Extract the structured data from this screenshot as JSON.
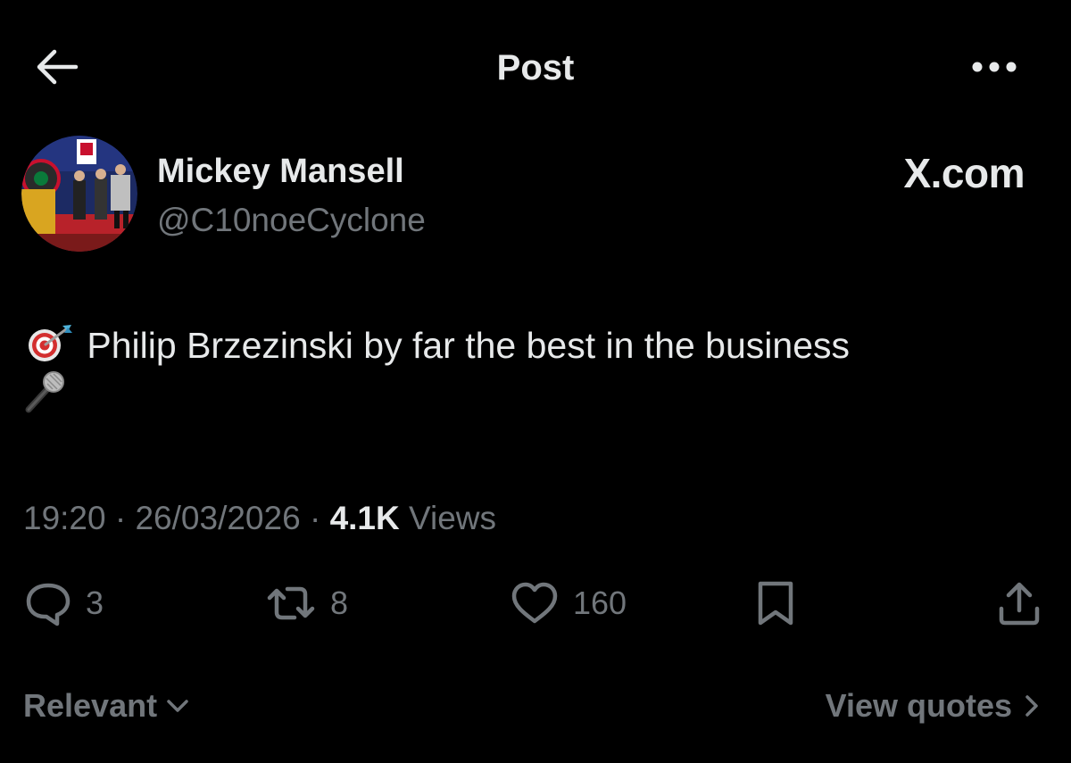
{
  "header": {
    "title": "Post",
    "back_icon": "arrow-left-icon",
    "more_icon": "more-horizontal-icon"
  },
  "author": {
    "display_name": "Mickey Mansell",
    "handle": "@C10noeCyclone",
    "brand": "X.com"
  },
  "post": {
    "text": "Philip Brzezinski by far the best in the business",
    "leading_emoji": "direct-hit-icon",
    "trailing_emoji": "microphone-icon"
  },
  "meta": {
    "time": "19:20",
    "separator": "·",
    "date": "26/03/2026",
    "views_count": "4.1K",
    "views_label": "Views"
  },
  "actions": {
    "replies": "3",
    "reposts": "8",
    "likes": "160"
  },
  "footer": {
    "sort_label": "Relevant",
    "view_quotes_label": "View quotes"
  },
  "colors": {
    "background": "#000000",
    "primary_text": "#e7e9ea",
    "secondary_text": "#71767b"
  }
}
